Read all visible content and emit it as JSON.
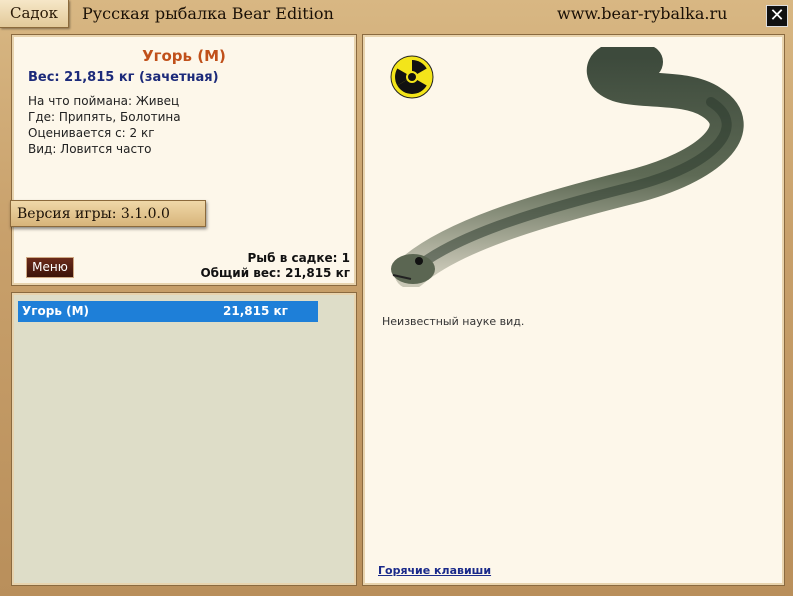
{
  "titlebar": {
    "tab_label": "Садок",
    "app_title": "Русская рыбалка Bear Edition",
    "site_url": "www.bear-rybalka.ru",
    "close_label": "✕"
  },
  "info": {
    "fish_name": "Угорь (М)",
    "weight_line": "Вес: 21,815 кг (зачетная)",
    "bait_line": "На что поймана: Живец",
    "where_line": "Где: Припять, Болотина",
    "rated_line": "Оценивается с: 2 кг",
    "kind_line": "Вид: Ловится часто",
    "version": "Версия игры: 3.1.0.0",
    "menu_label": "Меню",
    "fish_count": "Рыб в садке: 1",
    "total_weight": "Общий вес: 21,815 кг"
  },
  "list": {
    "rows": [
      {
        "name": "Угорь (М)",
        "weight": "21,815 кг"
      }
    ]
  },
  "detail": {
    "description": "Неизвестный науке вид.",
    "hotkeys_link": "Горячие клавиши",
    "hazard_icon": "radiation-icon"
  },
  "colors": {
    "fish_name": "#c0501a",
    "weight": "#1c2a7a",
    "selection": "#1e7fd8",
    "link": "#1a2a8a"
  }
}
